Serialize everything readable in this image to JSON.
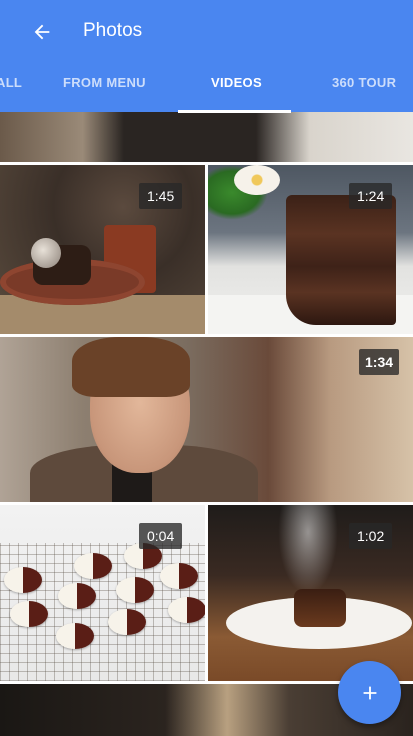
{
  "app": {
    "title": "Photos"
  },
  "tabs": [
    {
      "label": "ALL"
    },
    {
      "label": "FROM MENU"
    },
    {
      "label": "VIDEOS"
    },
    {
      "label": "360 TOUR"
    }
  ],
  "active_tab": "VIDEOS",
  "videos": [
    {
      "duration": "1:45"
    },
    {
      "duration": "1:24"
    },
    {
      "duration": "1:34"
    },
    {
      "duration": "0:04"
    },
    {
      "duration": "1:02"
    }
  ],
  "colors": {
    "accent": "#4a86f0",
    "badge": "#282828"
  },
  "icons": {
    "back": "arrow-back-icon",
    "add": "plus-icon"
  }
}
